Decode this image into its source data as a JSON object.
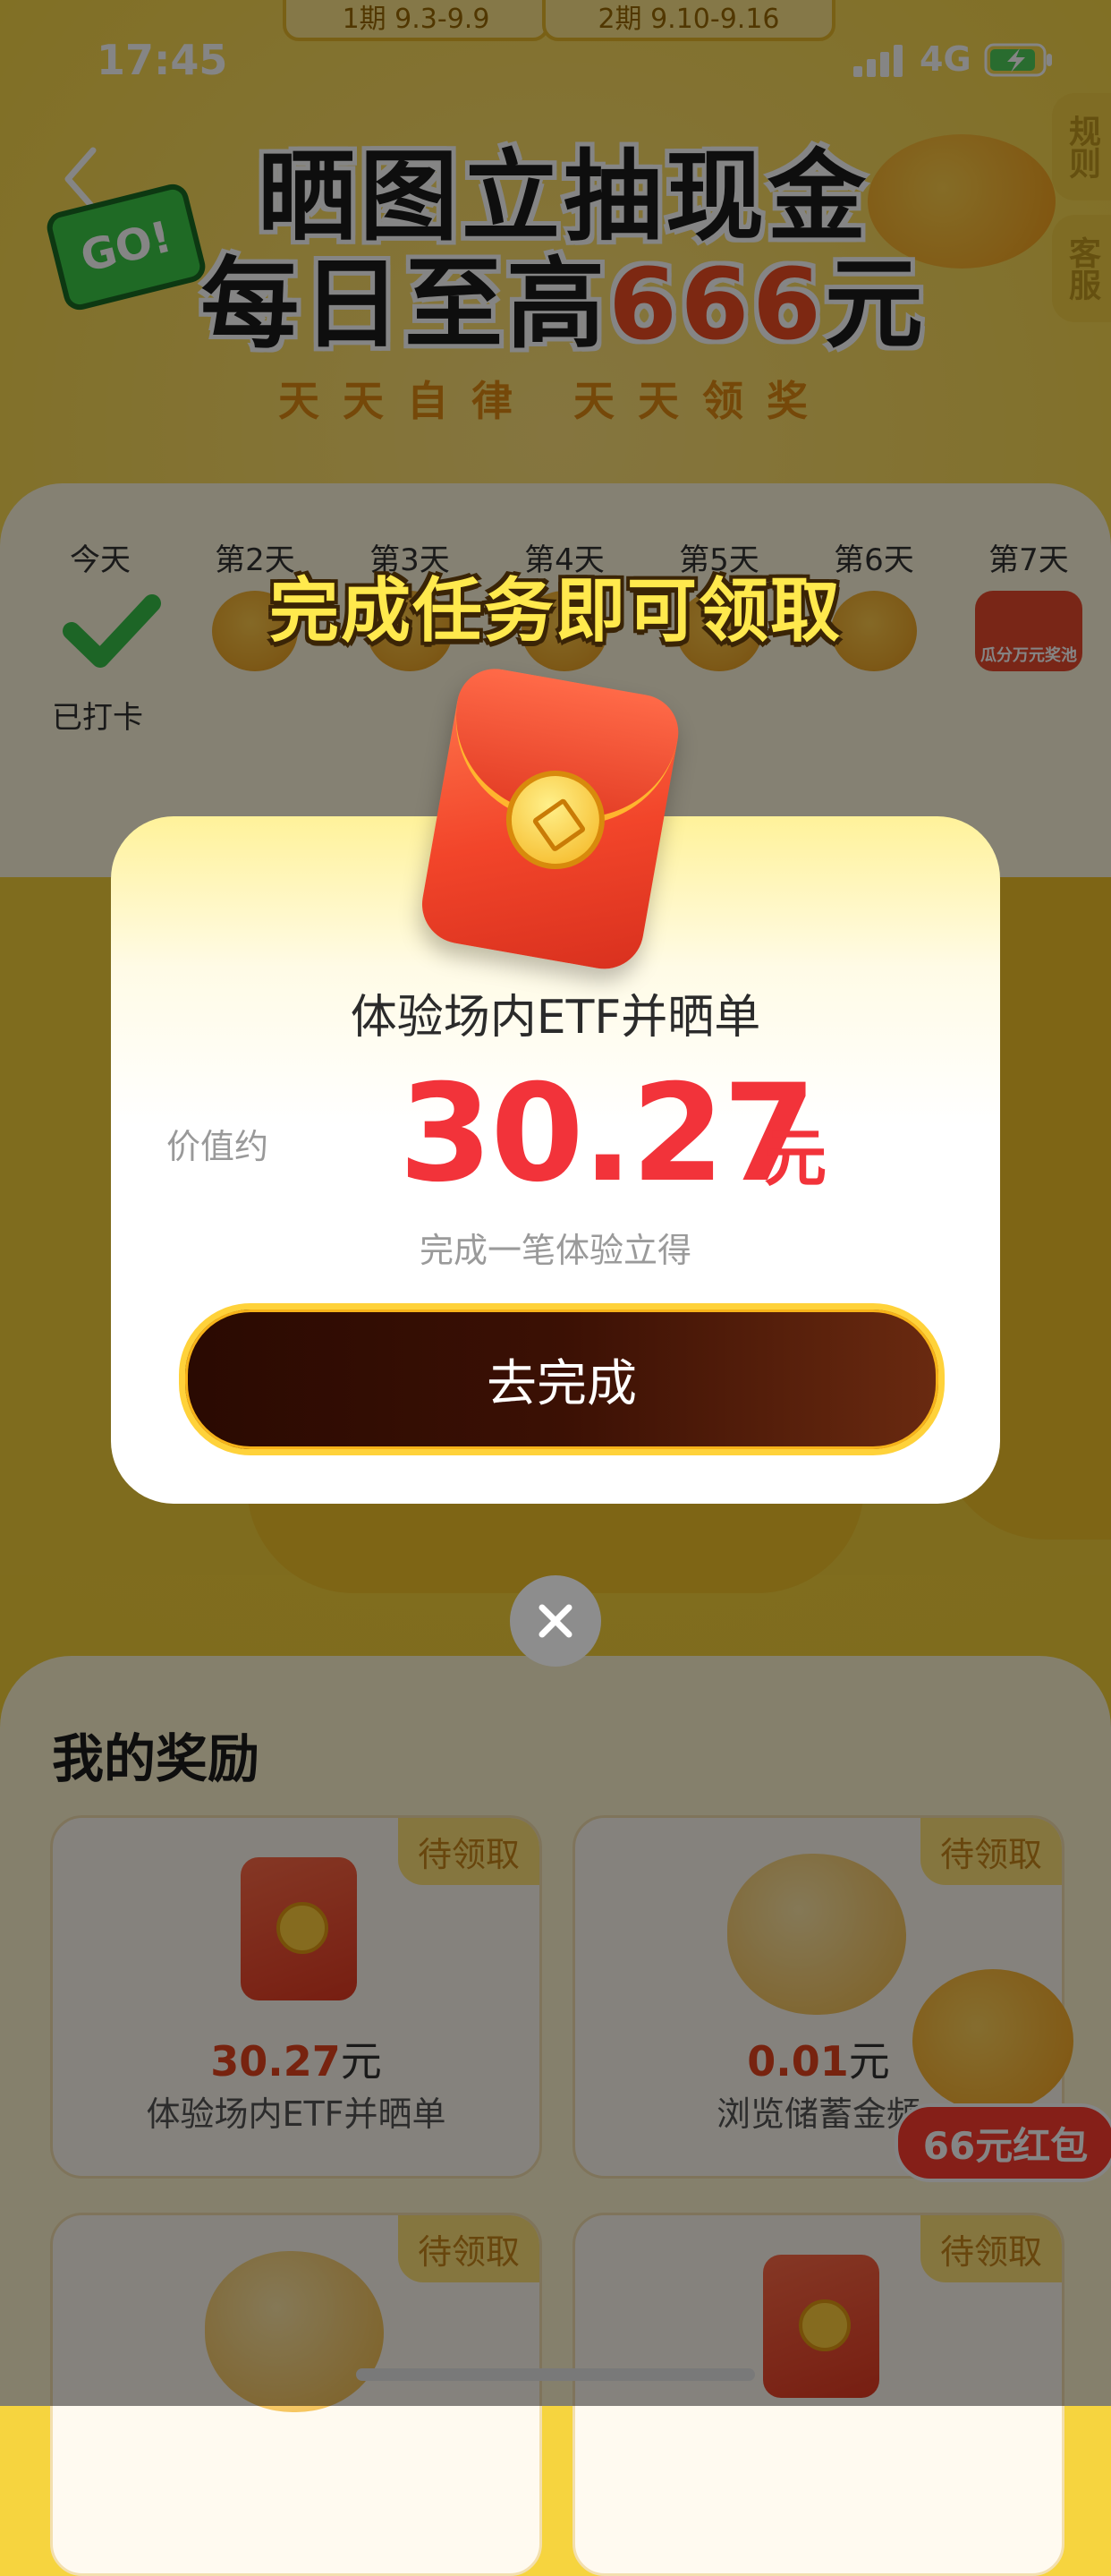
{
  "status_bar": {
    "time": "17:45",
    "network": "4G"
  },
  "period_tabs": [
    "1期 9.3-9.9",
    "2期 9.10-9.16"
  ],
  "side_buttons": {
    "rules": "规则",
    "service": "客服"
  },
  "hero": {
    "line1": "晒图立抽现金",
    "line2_prefix": "每日至高",
    "line2_amount": "666",
    "line2_suffix": "元",
    "subtitle": "天天自律  天天领奖",
    "go_badge": "GO!"
  },
  "checkin": {
    "days": [
      "今天",
      "第2天",
      "第3天",
      "第4天",
      "第5天",
      "第6天",
      "第7天"
    ],
    "today_status": "已打卡",
    "day7_reward": "瓜分万元奖池"
  },
  "modal": {
    "heading": "完成任务即可领取",
    "task_title": "体验场内ETF并晒单",
    "value_label": "价值约",
    "value_amount": "30.27",
    "value_unit": "元",
    "hint": "完成一笔体验立得",
    "button_label": "去完成"
  },
  "rewards": {
    "title": "我的奖励",
    "items": [
      {
        "tag": "待领取",
        "amount": "30.27",
        "unit": "元",
        "name": "体验场内ETF并晒单",
        "icon": "red-packet-icon"
      },
      {
        "tag": "待领取",
        "amount": "0.01",
        "unit": "元",
        "name": "浏览储蓄金频",
        "icon": "gold-bean-icon"
      },
      {
        "tag": "待领取",
        "icon": "gold-bean-icon"
      },
      {
        "tag": "待领取",
        "icon": "red-packet-icon"
      }
    ]
  },
  "floating_badge": "66元红包",
  "colors": {
    "accent_red": "#f2333a",
    "brand_yellow": "#f6d43f",
    "button_dark": "#2a0a02",
    "heading_yellow": "#ffe94d"
  }
}
